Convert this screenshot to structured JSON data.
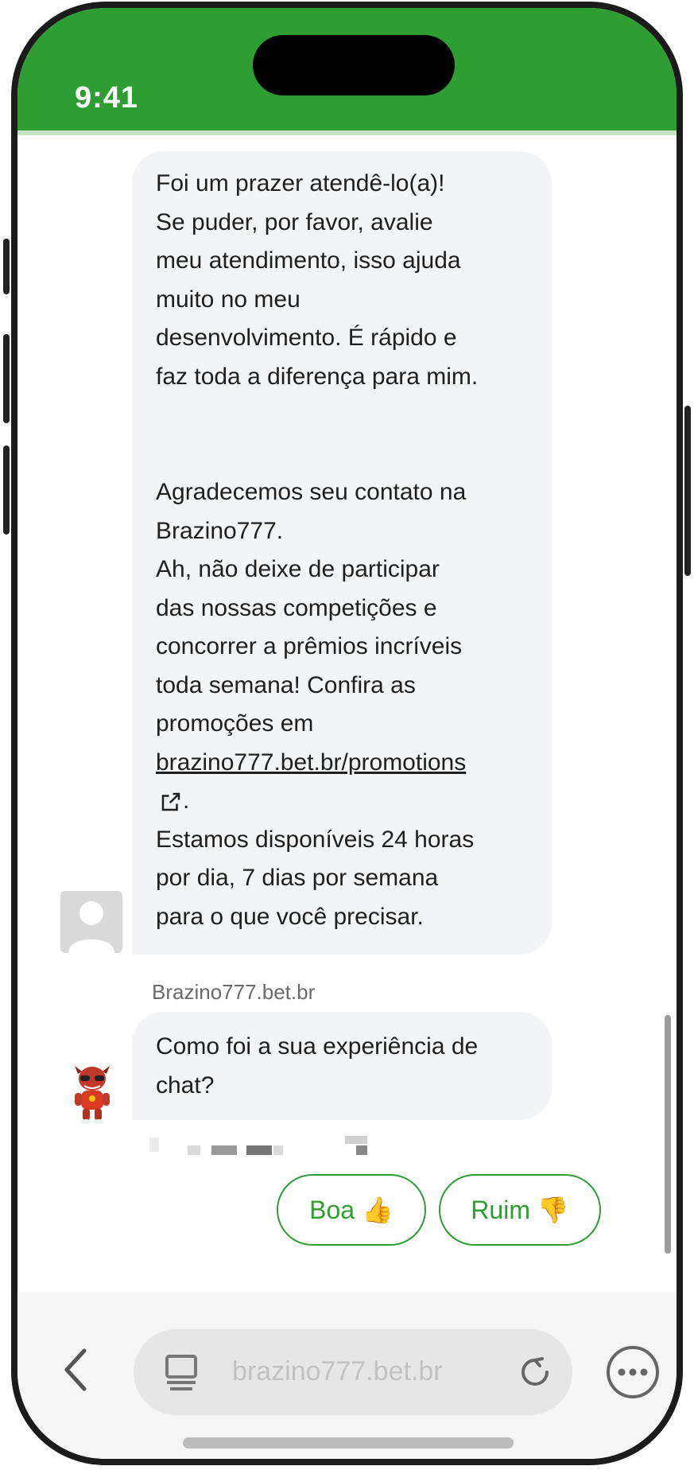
{
  "status_bar": {
    "time": "9:41",
    "color": "#2e9e32"
  },
  "messages": {
    "agent_paragraph_1": [
      "Foi um prazer atendê-lo(a)!",
      "Se puder, por favor, avalie",
      "meu atendimento, isso ajuda",
      "muito no meu",
      "desenvolvimento. É rápido e",
      "faz toda a diferença para mim."
    ],
    "agent_paragraph_2": [
      "Agradecemos seu contato na",
      "Brazino777.",
      "Ah, não deixe de participar",
      "das nossas competições e",
      "concorrer a prêmios incríveis",
      "toda semana! Confira as",
      "promoções em"
    ],
    "promo_link": "brazino777.bet.br/promotions",
    "link_suffix": ".",
    "agent_paragraph_3": [
      "Estamos disponíveis 24 horas",
      "por dia, 7 dias por semana",
      "para o que você precisar."
    ],
    "sender_name": "Brazino777.bet.br",
    "bot_question": [
      "Como foi a sua experiência de",
      "chat?"
    ]
  },
  "quick_replies": {
    "good": "Boa 👍",
    "bad": "Ruim 👎"
  },
  "browser": {
    "url": "brazino777.bet.br"
  },
  "icons": {
    "back": "chevron-left-icon",
    "tabs": "tabs-icon",
    "reload": "reload-icon",
    "more": "more-icon",
    "external_link": "external-link-icon"
  }
}
